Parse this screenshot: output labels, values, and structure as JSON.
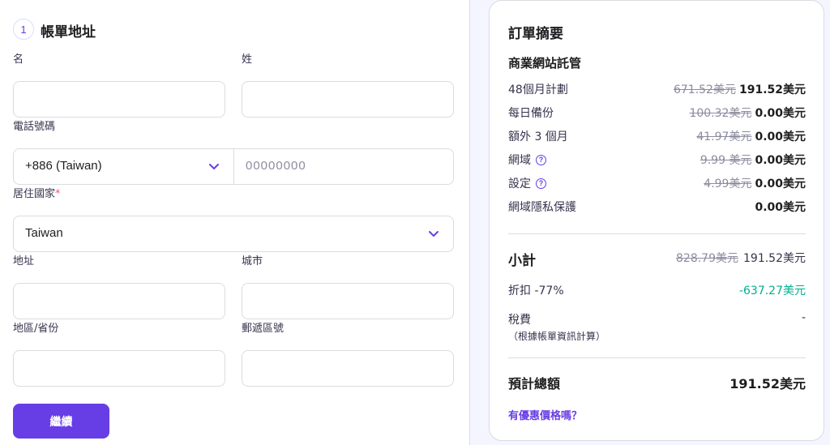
{
  "billing": {
    "step_number": "1",
    "title": "帳單地址",
    "first_name": {
      "label": "名",
      "value": ""
    },
    "last_name": {
      "label": "姓",
      "value": ""
    },
    "phone": {
      "label": "電話號碼",
      "country_code": "+886 (Taiwan)",
      "placeholder": "00000000"
    },
    "country": {
      "label": "居住國家",
      "required_mark": "*",
      "value": "Taiwan"
    },
    "address": {
      "label": "地址",
      "value": ""
    },
    "city": {
      "label": "城市",
      "value": ""
    },
    "region": {
      "label": "地區/省份",
      "value": ""
    },
    "postal": {
      "label": "郵遞區號",
      "value": ""
    },
    "continue_button": "繼續"
  },
  "summary": {
    "title": "訂單摘要",
    "product": "商業網站託管",
    "items": [
      {
        "label": "48個月計劃",
        "old_price": "671.52美元",
        "new_price": "191.52美元"
      },
      {
        "label": "每日備份",
        "old_price": "100.32美元",
        "new_price": "0.00美元"
      },
      {
        "label": "額外 3 個月",
        "old_price": "41.97美元",
        "new_price": "0.00美元"
      },
      {
        "label": "網域",
        "old_price": "9.99 美元",
        "new_price": "0.00美元"
      },
      {
        "label": "設定",
        "old_price": "4.99美元",
        "new_price": "0.00美元"
      },
      {
        "label": "網域隱私保護",
        "old_price": "",
        "new_price": "0.00美元"
      }
    ],
    "subtotal": {
      "label": "小計",
      "old_price": "828.79美元",
      "new_price": "191.52美元"
    },
    "discount": {
      "label": "折扣 -77%",
      "value": "-637.27美元"
    },
    "tax": {
      "label": "稅費",
      "note": "（根據帳單資訊計算）",
      "value": "-"
    },
    "total": {
      "label": "預計總額",
      "value": "191.52美元"
    },
    "coupon_link": "有優惠價格嗎？"
  },
  "colors": {
    "accent": "#673de6",
    "discount_green": "#00b090",
    "background": "#f4f5ff"
  }
}
